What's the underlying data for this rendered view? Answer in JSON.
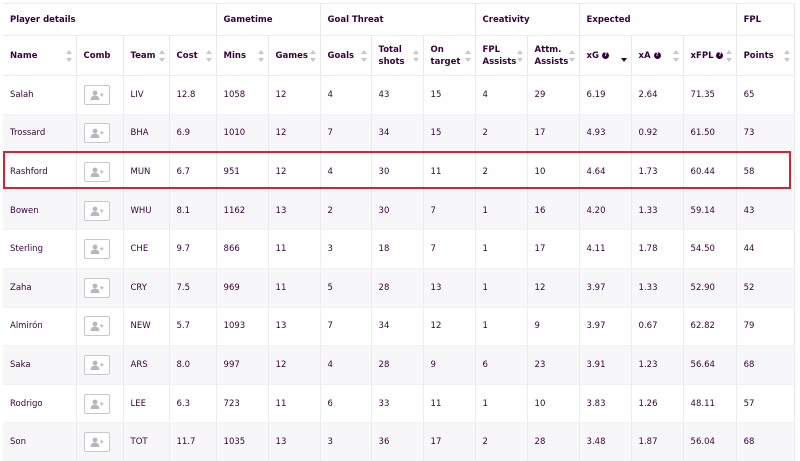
{
  "groups": [
    {
      "label": "Player details"
    },
    {
      "label": "Gametime"
    },
    {
      "label": "Goal Threat"
    },
    {
      "label": "Creativity"
    },
    {
      "label": "Expected"
    },
    {
      "label": "FPL"
    }
  ],
  "columns": [
    {
      "label": "Name",
      "sortable": true
    },
    {
      "label": "Comb",
      "sortable": false
    },
    {
      "label": "Team",
      "sortable": true
    },
    {
      "label": "Cost",
      "sortable": true
    },
    {
      "label": "Mins",
      "sortable": true
    },
    {
      "label": "Games",
      "sortable": true
    },
    {
      "label": "Goals",
      "sortable": true
    },
    {
      "label": "Total shots",
      "sortable": true
    },
    {
      "label": "On target",
      "sortable": true
    },
    {
      "label": "FPL Assists",
      "sortable": true
    },
    {
      "label": "Attm. Assists",
      "sortable": true
    },
    {
      "label": "xG",
      "sortable": true,
      "info": true,
      "active_sort": "desc"
    },
    {
      "label": "xA",
      "sortable": true,
      "info": true
    },
    {
      "label": "xFPL",
      "sortable": true,
      "info": true
    },
    {
      "label": "Points",
      "sortable": true
    }
  ],
  "info_glyph": "?",
  "rows": [
    {
      "name": "Salah",
      "team": "LIV",
      "cost": "12.8",
      "mins": "1058",
      "games": "12",
      "goals": "4",
      "shots": "43",
      "on_target": "15",
      "fpl_assists": "4",
      "attm_assists": "29",
      "xg": "6.19",
      "xa": "2.64",
      "xfpl": "71.35",
      "points": "65"
    },
    {
      "name": "Trossard",
      "team": "BHA",
      "cost": "6.9",
      "mins": "1010",
      "games": "12",
      "goals": "7",
      "shots": "34",
      "on_target": "15",
      "fpl_assists": "2",
      "attm_assists": "17",
      "xg": "4.93",
      "xa": "0.92",
      "xfpl": "61.50",
      "points": "73"
    },
    {
      "name": "Rashford",
      "team": "MUN",
      "cost": "6.7",
      "mins": "951",
      "games": "12",
      "goals": "4",
      "shots": "30",
      "on_target": "11",
      "fpl_assists": "2",
      "attm_assists": "10",
      "xg": "4.64",
      "xa": "1.73",
      "xfpl": "60.44",
      "points": "58",
      "highlighted": true
    },
    {
      "name": "Bowen",
      "team": "WHU",
      "cost": "8.1",
      "mins": "1162",
      "games": "13",
      "goals": "2",
      "shots": "30",
      "on_target": "7",
      "fpl_assists": "1",
      "attm_assists": "16",
      "xg": "4.20",
      "xa": "1.33",
      "xfpl": "59.14",
      "points": "43"
    },
    {
      "name": "Sterling",
      "team": "CHE",
      "cost": "9.7",
      "mins": "866",
      "games": "11",
      "goals": "3",
      "shots": "18",
      "on_target": "7",
      "fpl_assists": "1",
      "attm_assists": "17",
      "xg": "4.11",
      "xa": "1.78",
      "xfpl": "54.50",
      "points": "44"
    },
    {
      "name": "Zaha",
      "team": "CRY",
      "cost": "7.5",
      "mins": "969",
      "games": "11",
      "goals": "5",
      "shots": "28",
      "on_target": "13",
      "fpl_assists": "1",
      "attm_assists": "12",
      "xg": "3.97",
      "xa": "1.33",
      "xfpl": "52.90",
      "points": "52"
    },
    {
      "name": "Almirón",
      "team": "NEW",
      "cost": "5.7",
      "mins": "1093",
      "games": "13",
      "goals": "7",
      "shots": "34",
      "on_target": "12",
      "fpl_assists": "1",
      "attm_assists": "9",
      "xg": "3.97",
      "xa": "0.67",
      "xfpl": "62.82",
      "points": "79"
    },
    {
      "name": "Saka",
      "team": "ARS",
      "cost": "8.0",
      "mins": "997",
      "games": "12",
      "goals": "4",
      "shots": "28",
      "on_target": "9",
      "fpl_assists": "6",
      "attm_assists": "23",
      "xg": "3.91",
      "xa": "1.23",
      "xfpl": "56.64",
      "points": "68"
    },
    {
      "name": "Rodrigo",
      "team": "LEE",
      "cost": "6.3",
      "mins": "723",
      "games": "11",
      "goals": "6",
      "shots": "33",
      "on_target": "11",
      "fpl_assists": "1",
      "attm_assists": "10",
      "xg": "3.83",
      "xa": "1.26",
      "xfpl": "48.11",
      "points": "57"
    },
    {
      "name": "Son",
      "team": "TOT",
      "cost": "11.7",
      "mins": "1035",
      "games": "13",
      "goals": "3",
      "shots": "36",
      "on_target": "17",
      "fpl_assists": "2",
      "attm_assists": "28",
      "xg": "3.48",
      "xa": "1.87",
      "xfpl": "56.04",
      "points": "68"
    }
  ],
  "colors": {
    "text": "#37003c",
    "highlight": "#e01e2c",
    "row_alt": "#f7f7f9",
    "border": "#ececf0"
  },
  "icons": {
    "comb": "add-player-icon",
    "sort": "sort-arrows-icon",
    "info": "info-icon"
  }
}
